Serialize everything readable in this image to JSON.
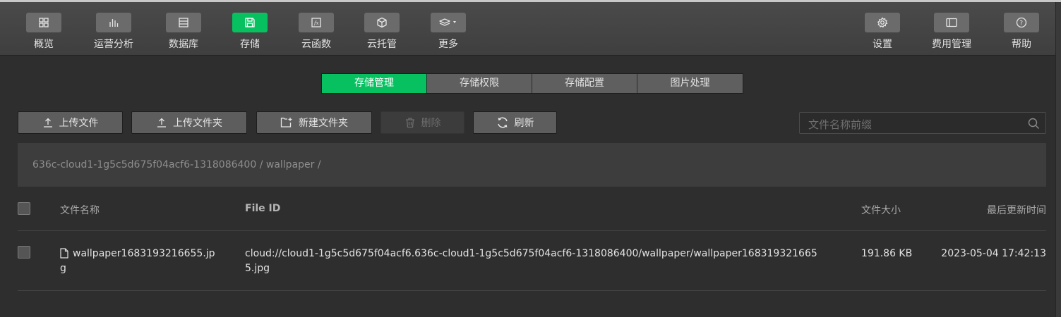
{
  "toolbar": {
    "left": [
      {
        "label": "概览",
        "icon": "grid-icon"
      },
      {
        "label": "运营分析",
        "icon": "bar-chart-icon"
      },
      {
        "label": "数据库",
        "icon": "database-icon"
      },
      {
        "label": "存储",
        "icon": "save-icon",
        "active": true
      },
      {
        "label": "云函数",
        "icon": "function-icon"
      },
      {
        "label": "云托管",
        "icon": "cube-icon"
      },
      {
        "label": "更多",
        "icon": "layers-icon"
      }
    ],
    "right": [
      {
        "label": "设置",
        "icon": "gear-icon"
      },
      {
        "label": "费用管理",
        "icon": "billing-icon"
      },
      {
        "label": "帮助",
        "icon": "help-icon"
      }
    ]
  },
  "tabs": [
    {
      "label": "存储管理",
      "active": true
    },
    {
      "label": "存储权限"
    },
    {
      "label": "存储配置"
    },
    {
      "label": "图片处理"
    }
  ],
  "actions": {
    "upload_file": "上传文件",
    "upload_folder": "上传文件夹",
    "new_folder": "新建文件夹",
    "delete": "删除",
    "refresh": "刷新"
  },
  "search": {
    "placeholder": "文件名称前缀"
  },
  "breadcrumb": {
    "root": "636c-cloud1-1g5c5d675f04acf6-1318086400",
    "separator": "/",
    "folder": "wallpaper"
  },
  "table": {
    "columns": {
      "name": "文件名称",
      "file_id": "File ID",
      "size": "文件大小",
      "updated": "最后更新时间"
    },
    "rows": [
      {
        "name_line1": "wallpaper1683193216655.jp",
        "name_line2": "g",
        "file_id_line1": "cloud://cloud1-1g5c5d675f04acf6.636c-cloud1-1g5c5d675f04acf6-1318086400/wallpaper/wallpaper168319321665",
        "file_id_line2": "5.jpg",
        "size": "191.86 KB",
        "updated": "2023-05-04 17:42:13"
      }
    ]
  },
  "colors": {
    "accent": "#07c160",
    "background": "#2e2e2e",
    "toolbar": "#444444"
  }
}
